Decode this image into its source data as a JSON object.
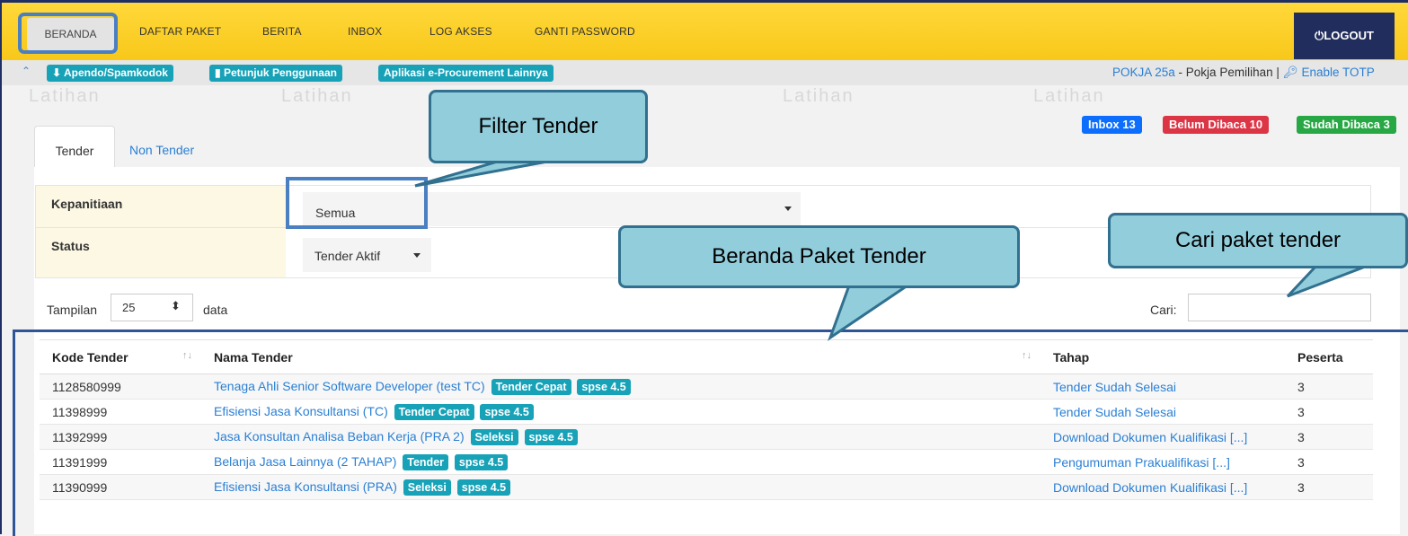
{
  "nav": {
    "home": "BERANDA",
    "items": [
      "DAFTAR PAKET",
      "BERITA",
      "INBOX",
      "LOG AKSES",
      "GANTI PASSWORD"
    ],
    "logout": "LOGOUT"
  },
  "subbar": {
    "buttons": [
      "Apendo/Spamkodok",
      "Petunjuk Penggunaan",
      "Aplikasi e-Procurement Lainnya"
    ],
    "user_panitia": "POKJA 25a",
    "user_role": " - Pokja Pemilihan | ",
    "totp": "Enable TOTP"
  },
  "watermark": "Latihan",
  "badges": {
    "inbox": "Inbox 13",
    "belum": "Belum Dibaca 10",
    "sudah": "Sudah Dibaca 3"
  },
  "tabs": [
    "Tender",
    "Non Tender"
  ],
  "filters": {
    "kepanitiaan_label": "Kepanitiaan",
    "kepanitiaan_value": "Semua",
    "status_label": "Status",
    "status_value": "Tender Aktif"
  },
  "table_controls": {
    "tampilan": "Tampilan",
    "page_size": "25",
    "data": "data",
    "cari": "Cari:"
  },
  "table": {
    "headers": [
      "Kode Tender",
      "Nama Tender",
      "Tahap",
      "Peserta"
    ],
    "rows": [
      {
        "kode": "1128580999",
        "nama": "Tenaga Ahli Senior Software Developer (test TC)",
        "tag1": "Tender Cepat",
        "tag2": "spse 4.5",
        "tahap": "Tender Sudah Selesai",
        "peserta": "3"
      },
      {
        "kode": "11398999",
        "nama": "Efisiensi Jasa Konsultansi (TC)",
        "tag1": "Tender Cepat",
        "tag2": "spse 4.5",
        "tahap": "Tender Sudah Selesai",
        "peserta": "3"
      },
      {
        "kode": "11392999",
        "nama": "Jasa Konsultan Analisa Beban Kerja (PRA 2)",
        "tag1": "Seleksi",
        "tag2": "spse 4.5",
        "tahap": "Download Dokumen Kualifikasi [...]",
        "peserta": "3"
      },
      {
        "kode": "11391999",
        "nama": "Belanja Jasa Lainnya (2 TAHAP)",
        "tag1": "Tender",
        "tag2": "spse 4.5",
        "tahap": "Pengumuman Prakualifikasi [...]",
        "peserta": "3"
      },
      {
        "kode": "11390999",
        "nama": "Efisiensi Jasa Konsultansi (PRA)",
        "tag1": "Seleksi",
        "tag2": "spse 4.5",
        "tahap": "Download Dokumen Kualifikasi [...]",
        "peserta": "3"
      }
    ]
  },
  "callouts": {
    "filter": "Filter Tender",
    "beranda": "Beranda Paket Tender",
    "cari": "Cari paket tender"
  },
  "colors": {
    "topbar": "#f8c81a",
    "logout_bg": "#212d5d",
    "tag": "#17a2b8",
    "inbox_badge": "#0d6efd",
    "belum_badge": "#dc3545",
    "sudah_badge": "#28a745",
    "callout_fill": "#92cddc",
    "highlight": "#4a7fc1"
  }
}
